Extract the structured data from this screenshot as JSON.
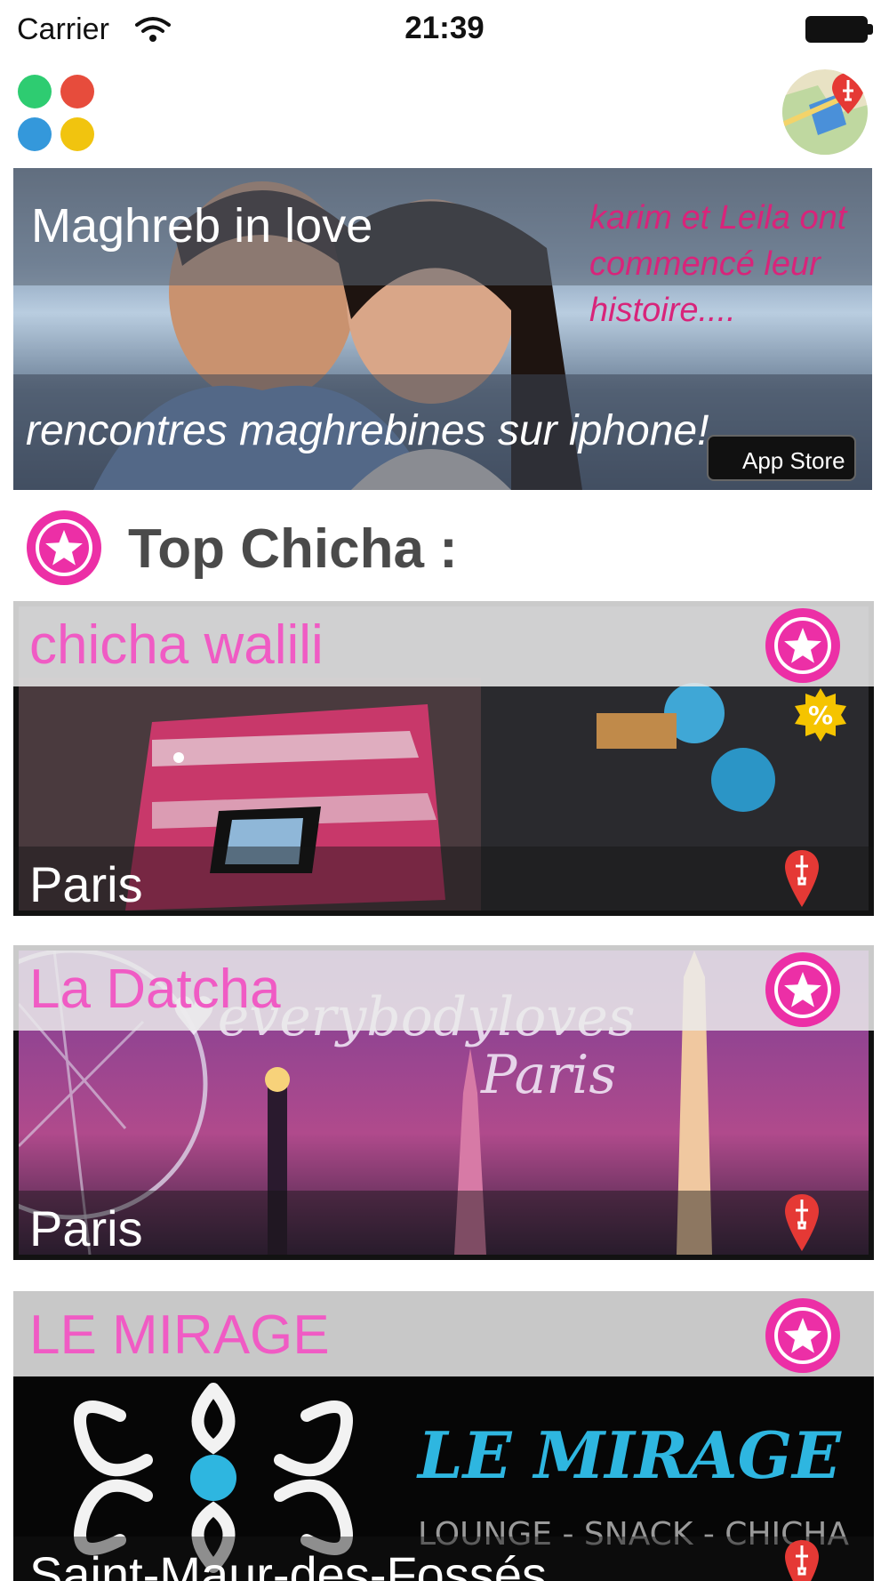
{
  "status_bar": {
    "carrier": "Carrier",
    "time": "21:39"
  },
  "header": {
    "menu_icon": "four-dots-grid-icon",
    "map_icon": "map-pin-icon",
    "dot_colors": [
      "#2ecc71",
      "#e74c3c",
      "#3498db",
      "#f1c40f"
    ]
  },
  "banner": {
    "title": "Maghreb in love",
    "tagline": "karim et  Leila ont commencé leur histoire....",
    "subtitle": "rencontres maghrebines sur iphone!",
    "store_label": "App Store"
  },
  "section": {
    "title": "Top Chicha :",
    "icon": "star-icon"
  },
  "venues": [
    {
      "name": "chicha walili",
      "city": "Paris",
      "has_promo": true,
      "promo_symbol": "%"
    },
    {
      "name": "La Datcha",
      "city": "Paris",
      "has_promo": false
    },
    {
      "name": "LE MIRAGE",
      "city": "Saint-Maur-des-Fossés",
      "has_promo": false,
      "logo_text": "LE MIRAGE",
      "logo_subtext": "LOUNGE - SNACK - CHICHA"
    }
  ],
  "colors": {
    "accent_pink": "#ec2fa6",
    "venue_name_pink": "#f05bc4",
    "pin_red": "#e53935",
    "promo_yellow": "#f5c400"
  }
}
